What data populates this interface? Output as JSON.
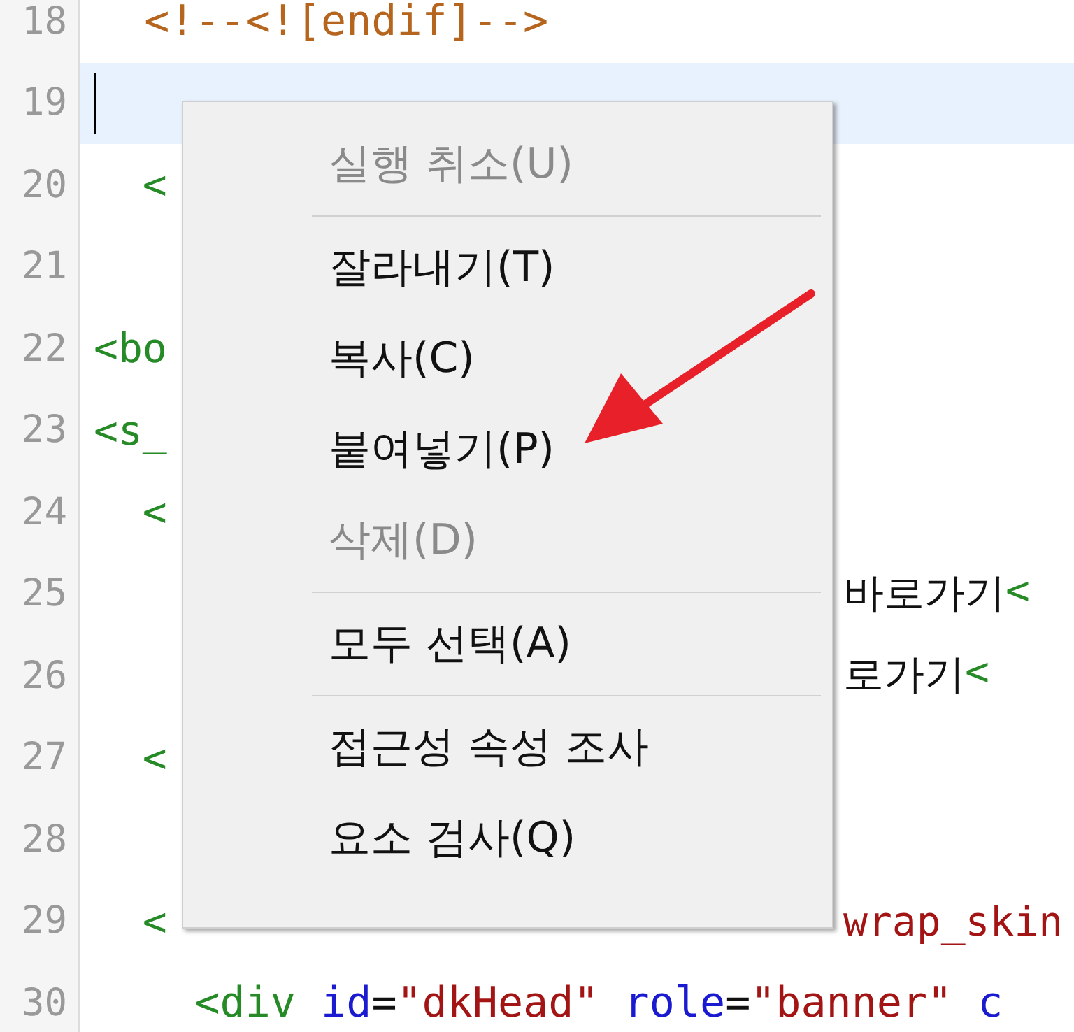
{
  "editor": {
    "lines": [
      {
        "number": "18",
        "kind": "full",
        "highlighted": false,
        "tokens": [
          {
            "text": "  <!--<![endif]-->",
            "kind": "comment"
          }
        ]
      },
      {
        "number": "19",
        "kind": "full",
        "highlighted": true
      },
      {
        "number": "20",
        "kind": "split",
        "highlighted": false,
        "before": [
          {
            "text": "  <",
            "kind": "tag"
          }
        ]
      },
      {
        "number": "21",
        "kind": "split",
        "highlighted": false
      },
      {
        "number": "22",
        "kind": "split",
        "highlighted": false,
        "before": [
          {
            "text": "<bo",
            "kind": "tag"
          }
        ]
      },
      {
        "number": "23",
        "kind": "split",
        "highlighted": false,
        "before": [
          {
            "text": "<s_",
            "kind": "tag"
          }
        ]
      },
      {
        "number": "24",
        "kind": "split",
        "highlighted": false,
        "before": [
          {
            "text": "  <",
            "kind": "tag"
          }
        ]
      },
      {
        "number": "25",
        "kind": "split",
        "highlighted": false,
        "after": [
          {
            "text": "바로가기",
            "kind": "text"
          },
          {
            "text": "<",
            "kind": "tag"
          }
        ]
      },
      {
        "number": "26",
        "kind": "split",
        "highlighted": false,
        "after": [
          {
            "text": "로가기",
            "kind": "text"
          },
          {
            "text": "<",
            "kind": "tag"
          }
        ]
      },
      {
        "number": "27",
        "kind": "split",
        "highlighted": false,
        "before": [
          {
            "text": "  <",
            "kind": "tag"
          }
        ]
      },
      {
        "number": "28",
        "kind": "split",
        "highlighted": false
      },
      {
        "number": "29",
        "kind": "split",
        "highlighted": false,
        "before": [
          {
            "text": "  <",
            "kind": "tag"
          }
        ],
        "after": [
          {
            "text": "wrap_skin",
            "kind": "value"
          }
        ]
      },
      {
        "number": "30",
        "kind": "full",
        "highlighted": false,
        "tokens": [
          {
            "text": "    <div",
            "kind": "tag"
          },
          {
            "text": " id",
            "kind": "attr"
          },
          {
            "text": "=",
            "kind": "text"
          },
          {
            "text": "\"dkHead\"",
            "kind": "value"
          },
          {
            "text": " role",
            "kind": "attr"
          },
          {
            "text": "=",
            "kind": "text"
          },
          {
            "text": "\"banner\"",
            "kind": "value"
          },
          {
            "text": " c",
            "kind": "attr"
          }
        ]
      }
    ]
  },
  "context_menu": {
    "items": [
      {
        "kind": "item",
        "label": "실행 취소(U)",
        "disabled": true
      },
      {
        "kind": "separator"
      },
      {
        "kind": "item",
        "label": "잘라내기(T)",
        "disabled": false
      },
      {
        "kind": "item",
        "label": "복사(C)",
        "disabled": false
      },
      {
        "kind": "item",
        "label": "붙여넣기(P)",
        "disabled": false
      },
      {
        "kind": "item",
        "label": "삭제(D)",
        "disabled": true
      },
      {
        "kind": "separator"
      },
      {
        "kind": "item",
        "label": "모두 선택(A)",
        "disabled": false
      },
      {
        "kind": "separator"
      },
      {
        "kind": "item",
        "label": "접근성 속성 조사",
        "disabled": false
      },
      {
        "kind": "item",
        "label": "요소 검사(Q)",
        "disabled": false
      }
    ]
  }
}
